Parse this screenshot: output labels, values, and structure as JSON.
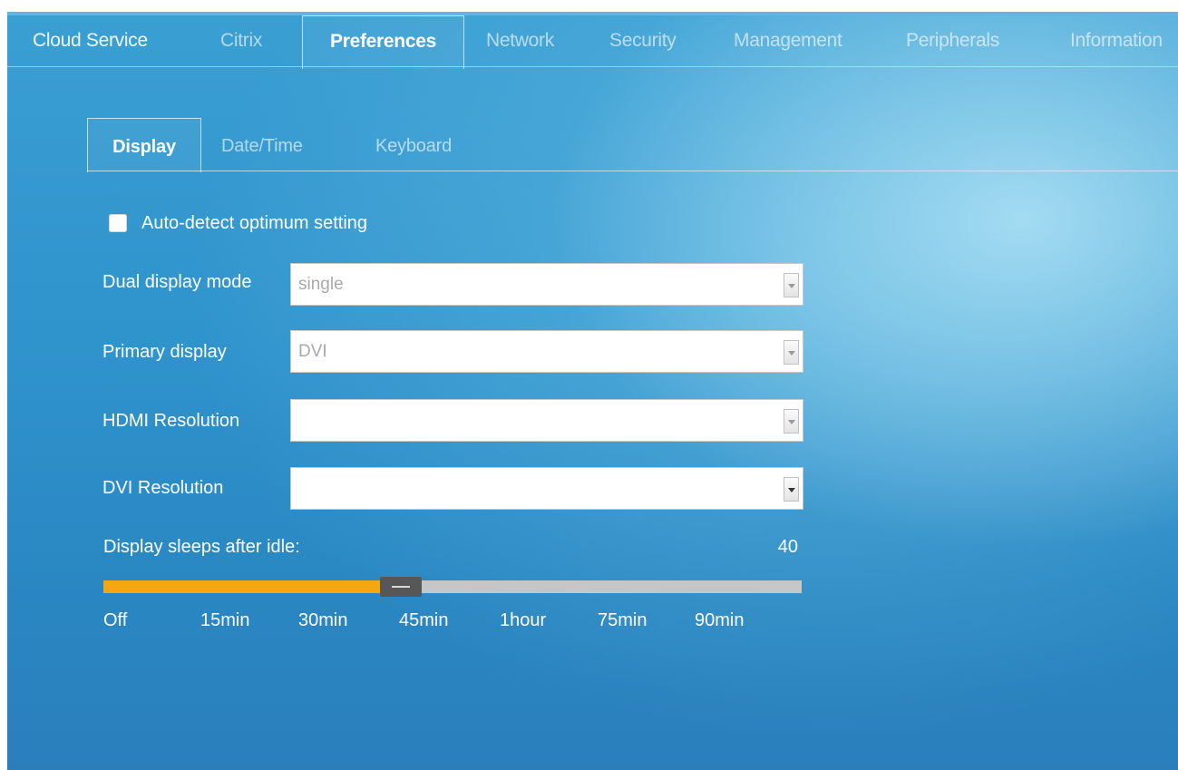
{
  "top_tabs": [
    {
      "label": "Cloud Service"
    },
    {
      "label": "Citrix"
    },
    {
      "label": "Preferences"
    },
    {
      "label": "Network"
    },
    {
      "label": "Security"
    },
    {
      "label": "Management"
    },
    {
      "label": "Peripherals"
    },
    {
      "label": "Information"
    }
  ],
  "active_top_tab": "Preferences",
  "sub_tabs": [
    {
      "label": "Display"
    },
    {
      "label": "Date/Time"
    },
    {
      "label": "Keyboard"
    }
  ],
  "active_sub_tab": "Display",
  "auto_detect": {
    "label": "Auto-detect optimum setting",
    "checked": false
  },
  "fields": {
    "dual_display_mode": {
      "label": "Dual display mode",
      "value": "single"
    },
    "primary_display": {
      "label": "Primary display",
      "value": "DVI"
    },
    "hdmi_resolution": {
      "label": "HDMI Resolution",
      "value": ""
    },
    "dvi_resolution": {
      "label": "DVI Resolution",
      "value": ""
    }
  },
  "sleep": {
    "label": "Display sleeps after idle:",
    "value": "40",
    "level_fraction": 0.405,
    "ticks": [
      "Off",
      "15min",
      "30min",
      "45min",
      "1hour",
      "75min",
      "90min"
    ]
  },
  "colors": {
    "background": "#2f93cc",
    "slider_fill": "#f5a70f",
    "slider_track": "#c6c6c6",
    "slider_handle": "#575757"
  },
  "icons": {
    "dropdown": "chevron-down-icon",
    "slider_grip": "grip-icon"
  }
}
